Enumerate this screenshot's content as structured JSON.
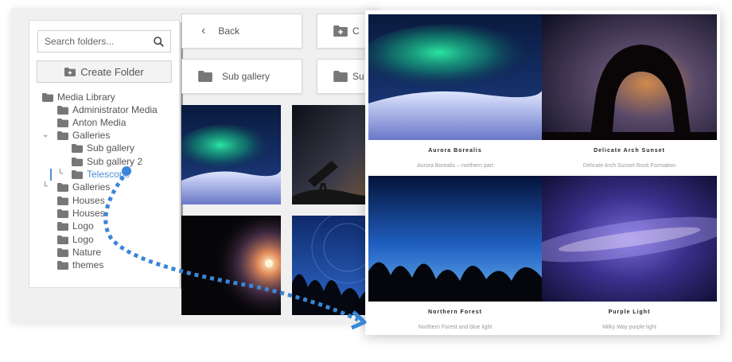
{
  "sidebar": {
    "search_placeholder": "Search folders...",
    "create_label": "Create Folder",
    "tree": [
      {
        "label": "Media Library"
      },
      {
        "label": "Administrator Media"
      },
      {
        "label": "Anton Media"
      },
      {
        "label": "Galleries"
      },
      {
        "label": "Sub gallery"
      },
      {
        "label": "Sub gallery 2"
      },
      {
        "label": "Telescope",
        "active": true
      },
      {
        "label": "Galleries"
      },
      {
        "label": "Houses"
      },
      {
        "label": "Houses"
      },
      {
        "label": "Logo"
      },
      {
        "label": "Logo"
      },
      {
        "label": "Nature"
      },
      {
        "label": "themes"
      }
    ]
  },
  "toolbar": {
    "back_label": "Back",
    "create_partial": "C",
    "sub_gallery_label": "Sub gallery",
    "sub_partial": "Su"
  },
  "gallery": {
    "items": [
      {
        "title": "Aurora Borealis",
        "caption": "Aurora Borealis – northern part"
      },
      {
        "title": "Delicate Arch Sunset",
        "caption": "Delicate Arch Sunset Rock Formation"
      },
      {
        "title": "Northern Forest",
        "caption": "Northern Forest and blue light"
      },
      {
        "title": "Purple Light",
        "caption": "Milky Way purple light"
      }
    ]
  },
  "colors": {
    "accent": "#4a8fd6",
    "folder": "#777777"
  }
}
